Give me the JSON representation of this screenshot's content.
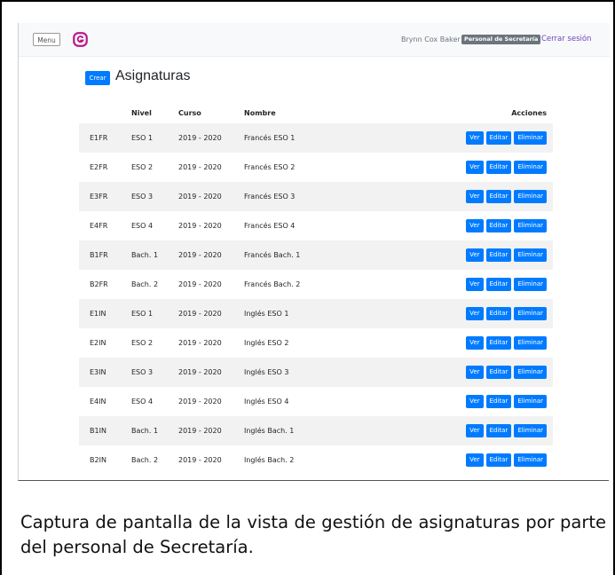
{
  "navbar": {
    "menu_label": "Menu",
    "logo_icon": "g-logo-icon",
    "user_name": "Brynn Cox Baker",
    "user_role": "Personal de Secretaría",
    "logout_label": "Cerrar sesión"
  },
  "page": {
    "create_label": "Crear",
    "title": "Asignaturas"
  },
  "table": {
    "headers": {
      "code": "",
      "nivel": "Nivel",
      "curso": "Curso",
      "nombre": "Nombre",
      "acciones": "Acciones"
    },
    "actions": {
      "view": "Ver",
      "edit": "Editar",
      "delete": "Eliminar"
    },
    "rows": [
      {
        "code": "E1FR",
        "nivel": "ESO 1",
        "curso": "2019 - 2020",
        "nombre": "Francés ESO 1"
      },
      {
        "code": "E2FR",
        "nivel": "ESO 2",
        "curso": "2019 - 2020",
        "nombre": "Francés ESO 2"
      },
      {
        "code": "E3FR",
        "nivel": "ESO 3",
        "curso": "2019 - 2020",
        "nombre": "Francés ESO 3"
      },
      {
        "code": "E4FR",
        "nivel": "ESO 4",
        "curso": "2019 - 2020",
        "nombre": "Francés ESO 4"
      },
      {
        "code": "B1FR",
        "nivel": "Bach. 1",
        "curso": "2019 - 2020",
        "nombre": "Francés Bach. 1"
      },
      {
        "code": "B2FR",
        "nivel": "Bach. 2",
        "curso": "2019 - 2020",
        "nombre": "Francés Bach. 2"
      },
      {
        "code": "E1IN",
        "nivel": "ESO 1",
        "curso": "2019 - 2020",
        "nombre": "Inglés ESO 1"
      },
      {
        "code": "E2IN",
        "nivel": "ESO 2",
        "curso": "2019 - 2020",
        "nombre": "Inglés ESO 2"
      },
      {
        "code": "E3IN",
        "nivel": "ESO 3",
        "curso": "2019 - 2020",
        "nombre": "Inglés ESO 3"
      },
      {
        "code": "E4IN",
        "nivel": "ESO 4",
        "curso": "2019 - 2020",
        "nombre": "Inglés ESO 4"
      },
      {
        "code": "B1IN",
        "nivel": "Bach. 1",
        "curso": "2019 - 2020",
        "nombre": "Inglés Bach. 1"
      },
      {
        "code": "B2IN",
        "nivel": "Bach. 2",
        "curso": "2019 - 2020",
        "nombre": "Inglés Bach. 2"
      }
    ]
  },
  "caption": "Captura de pantalla de la vista de gestión de asignaturas por parte del personal de Secretaría.",
  "colors": {
    "primary": "#007bff",
    "logo": "#b8188a",
    "logout": "#6f42c1",
    "badge": "#6c757d"
  }
}
